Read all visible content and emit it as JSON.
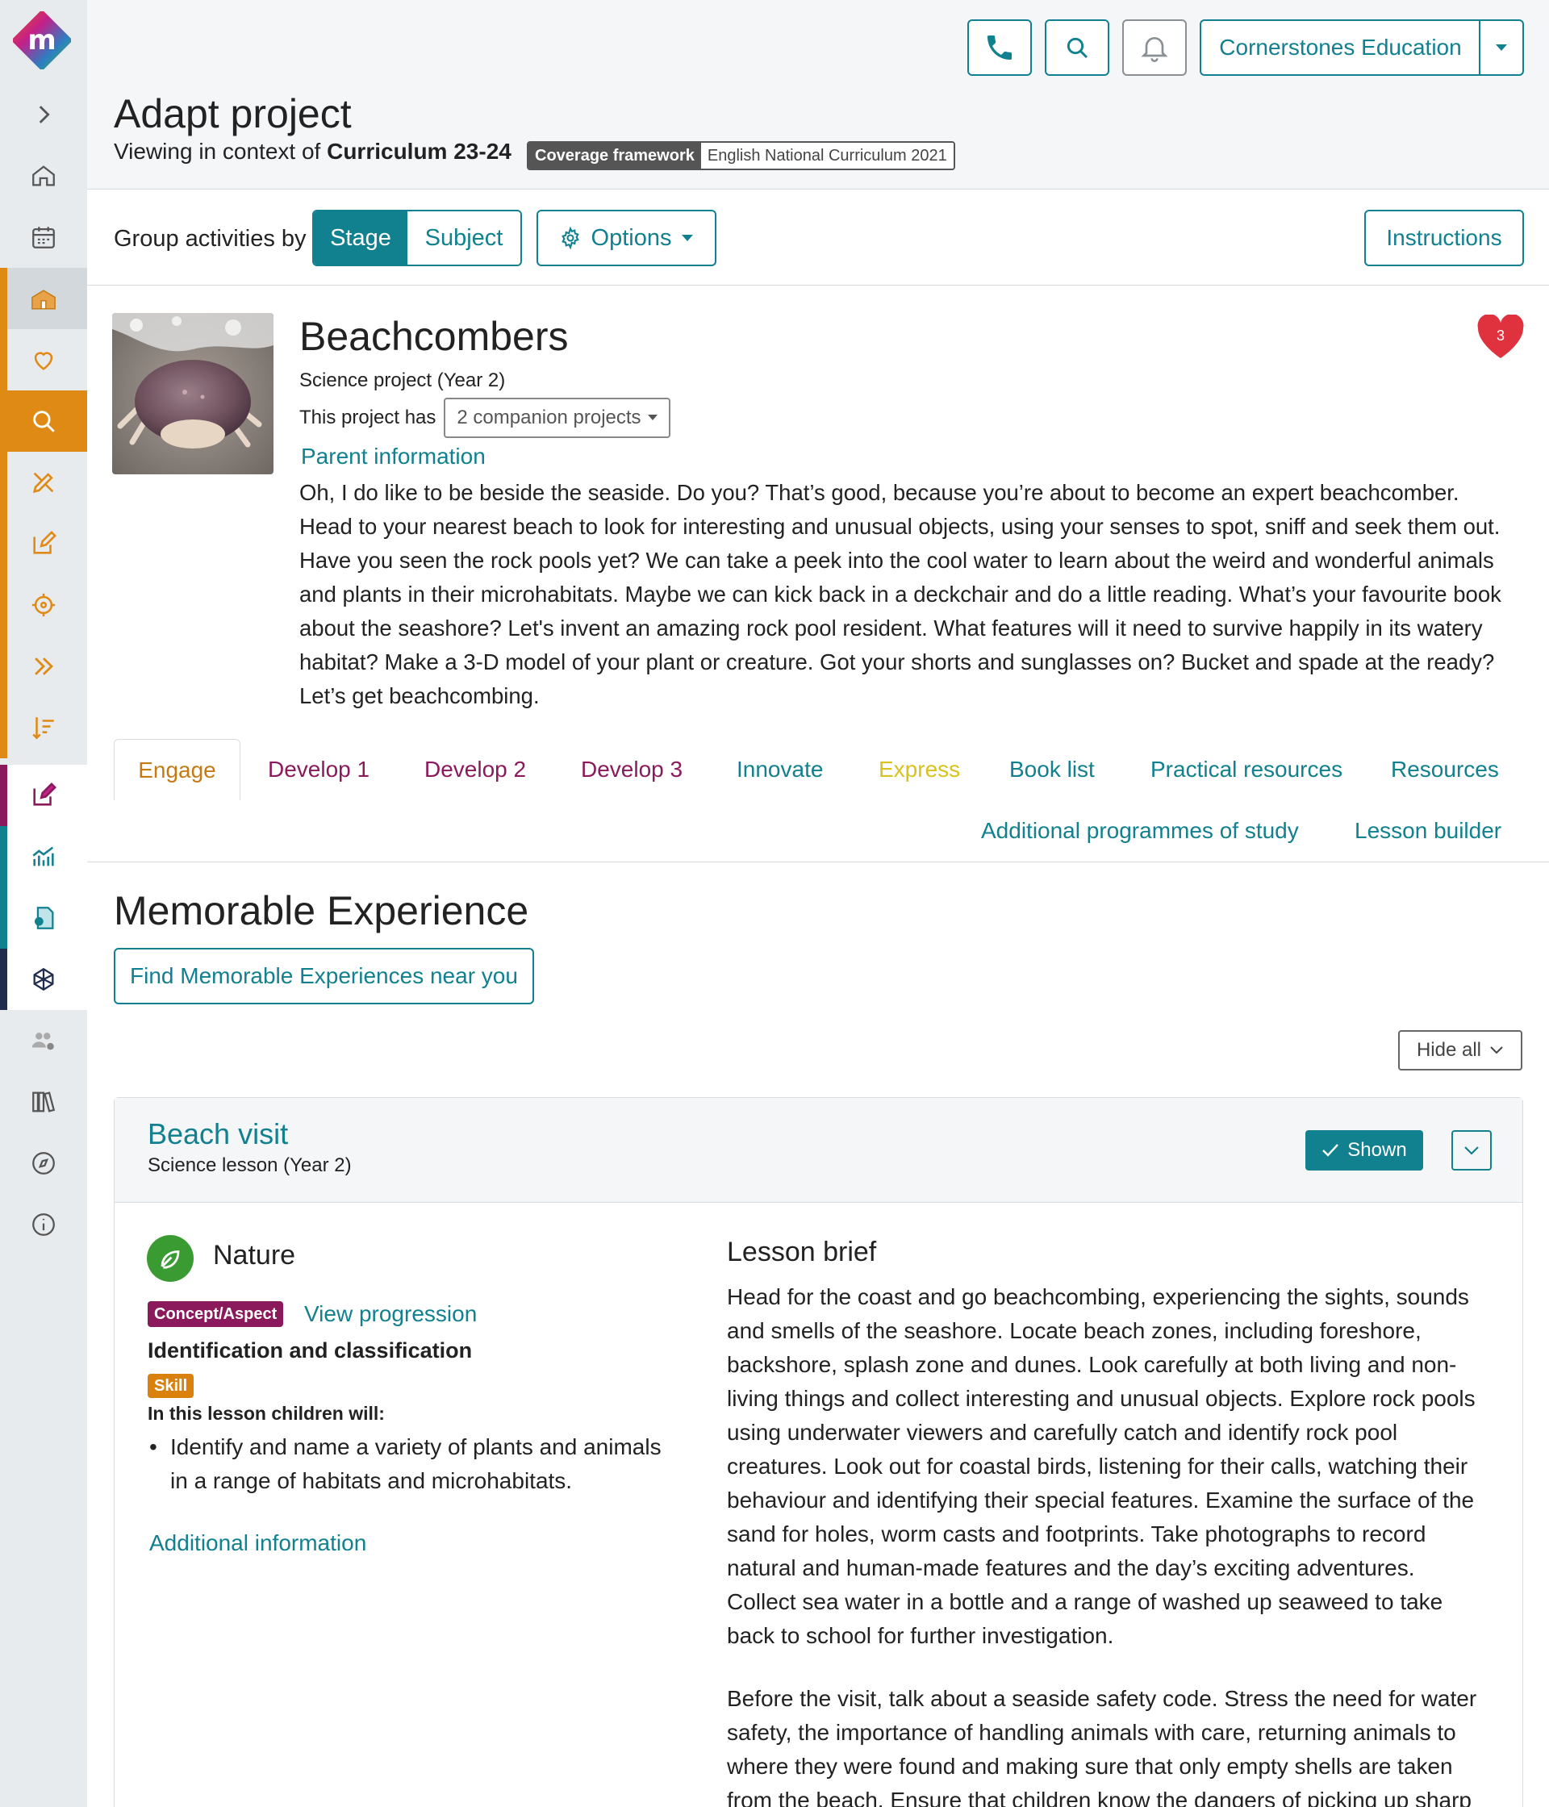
{
  "sidebar": {
    "items": [
      {
        "icon": "chevron-right-icon"
      },
      {
        "icon": "home-icon"
      },
      {
        "icon": "calendar-icon"
      },
      {
        "icon": "school-icon"
      },
      {
        "icon": "heart-icon"
      },
      {
        "icon": "search-icon"
      },
      {
        "icon": "pencil-ruler-icon"
      },
      {
        "icon": "edit-icon"
      },
      {
        "icon": "target-icon"
      },
      {
        "icon": "double-chevron-icon"
      },
      {
        "icon": "sort-icon"
      },
      {
        "icon": "assessment-icon"
      },
      {
        "icon": "chart-icon"
      },
      {
        "icon": "certificate-icon"
      },
      {
        "icon": "network-icon"
      },
      {
        "icon": "users-settings-icon"
      },
      {
        "icon": "library-icon"
      },
      {
        "icon": "compass-icon"
      },
      {
        "icon": "info-icon"
      }
    ]
  },
  "header": {
    "organisation": "Cornerstones Education",
    "title": "Adapt project",
    "context_prefix": "Viewing in context of",
    "context_value": "Curriculum 23-24",
    "framework_label": "Coverage framework",
    "framework_value": "English National Curriculum 2021"
  },
  "toolbar": {
    "group_label": "Group activities by",
    "stage": "Stage",
    "subject": "Subject",
    "options": "Options",
    "instructions": "Instructions"
  },
  "project": {
    "title": "Beachcombers",
    "subtitle": "Science project (Year 2)",
    "companion_prefix": "This project has",
    "companion_value": "2 companion projects",
    "parent_info": "Parent information",
    "favourites_count": "3",
    "description": "Oh, I do like to be beside the seaside. Do you? That’s good, because you’re about to become an expert beachcomber. Head to your nearest beach to look for interesting and unusual objects, using your senses to spot, sniff and seek them out. Have you seen the rock pools yet? We can take a peek into the cool water to learn about the weird and wonderful animals and plants in their microhabitats. Maybe we can kick back in a deckchair and do a little reading. What’s your favourite book about the seashore? Let's invent an amazing rock pool resident. What features will it need to survive happily in its watery habitat? Make a 3-D model of your plant or creature. Got your shorts and sunglasses on? Bucket and spade at the ready? Let’s get beachcombing."
  },
  "tabs": [
    {
      "label": "Engage",
      "color": "#c57a12"
    },
    {
      "label": "Develop 1",
      "color": "#8b1a5c"
    },
    {
      "label": "Develop 2",
      "color": "#8b1a5c"
    },
    {
      "label": "Develop 3",
      "color": "#8b1a5c"
    },
    {
      "label": "Innovate",
      "color": "#11808f"
    },
    {
      "label": "Express",
      "color": "#d9c21b"
    },
    {
      "label": "Book list",
      "color": "#11808f"
    },
    {
      "label": "Practical resources",
      "color": "#11808f"
    },
    {
      "label": "Resources",
      "color": "#11808f"
    },
    {
      "label": "Additional programmes of study",
      "color": "#11808f"
    },
    {
      "label": "Lesson builder",
      "color": "#11808f"
    }
  ],
  "section": {
    "title": "Memorable Experience",
    "find_button": "Find Memorable Experiences near you",
    "hide_all": "Hide all"
  },
  "lesson": {
    "title": "Beach visit",
    "subtitle": "Science lesson (Year 2)",
    "shown": "Shown",
    "concept_area": "Nature",
    "concept_badge": "Concept/Aspect",
    "view_progression": "View progression",
    "concept_title": "Identification and classification",
    "skill_badge": "Skill",
    "children_will": "In this lesson children will:",
    "outcomes": [
      "Identify and name a variety of plants and animals in a range of habitats and microhabitats."
    ],
    "additional_info": "Additional information",
    "brief_title": "Lesson brief",
    "brief_p1": "Head for the coast and go beachcombing, experiencing the sights, sounds and smells of the seashore. Locate beach zones, including foreshore, backshore, splash zone and dunes. Look carefully at both living and non-living things and collect interesting and unusual objects. Explore rock pools using underwater viewers and carefully catch and identify rock pool creatures. Look out for coastal birds, listening for their calls, watching their behaviour and identifying their special features. Examine the surface of the sand for holes, worm casts and footprints. Take photographs to record natural and human-made features and the day’s exciting adventures. Collect sea water in a bottle and a range of washed up seaweed to take back to school for further investigation.",
    "brief_p2": "Before the visit, talk about a seaside safety code. Stress the need for water safety, the importance of handling animals with care, returning animals to where they were found and making sure that only empty shells are taken from the beach. Ensure that children know the dangers of picking up sharp or"
  },
  "colors": {
    "accent": "#11808f",
    "orange": "#d9800d",
    "magenta": "#8b1a5c",
    "navy": "#1f2d4d"
  }
}
